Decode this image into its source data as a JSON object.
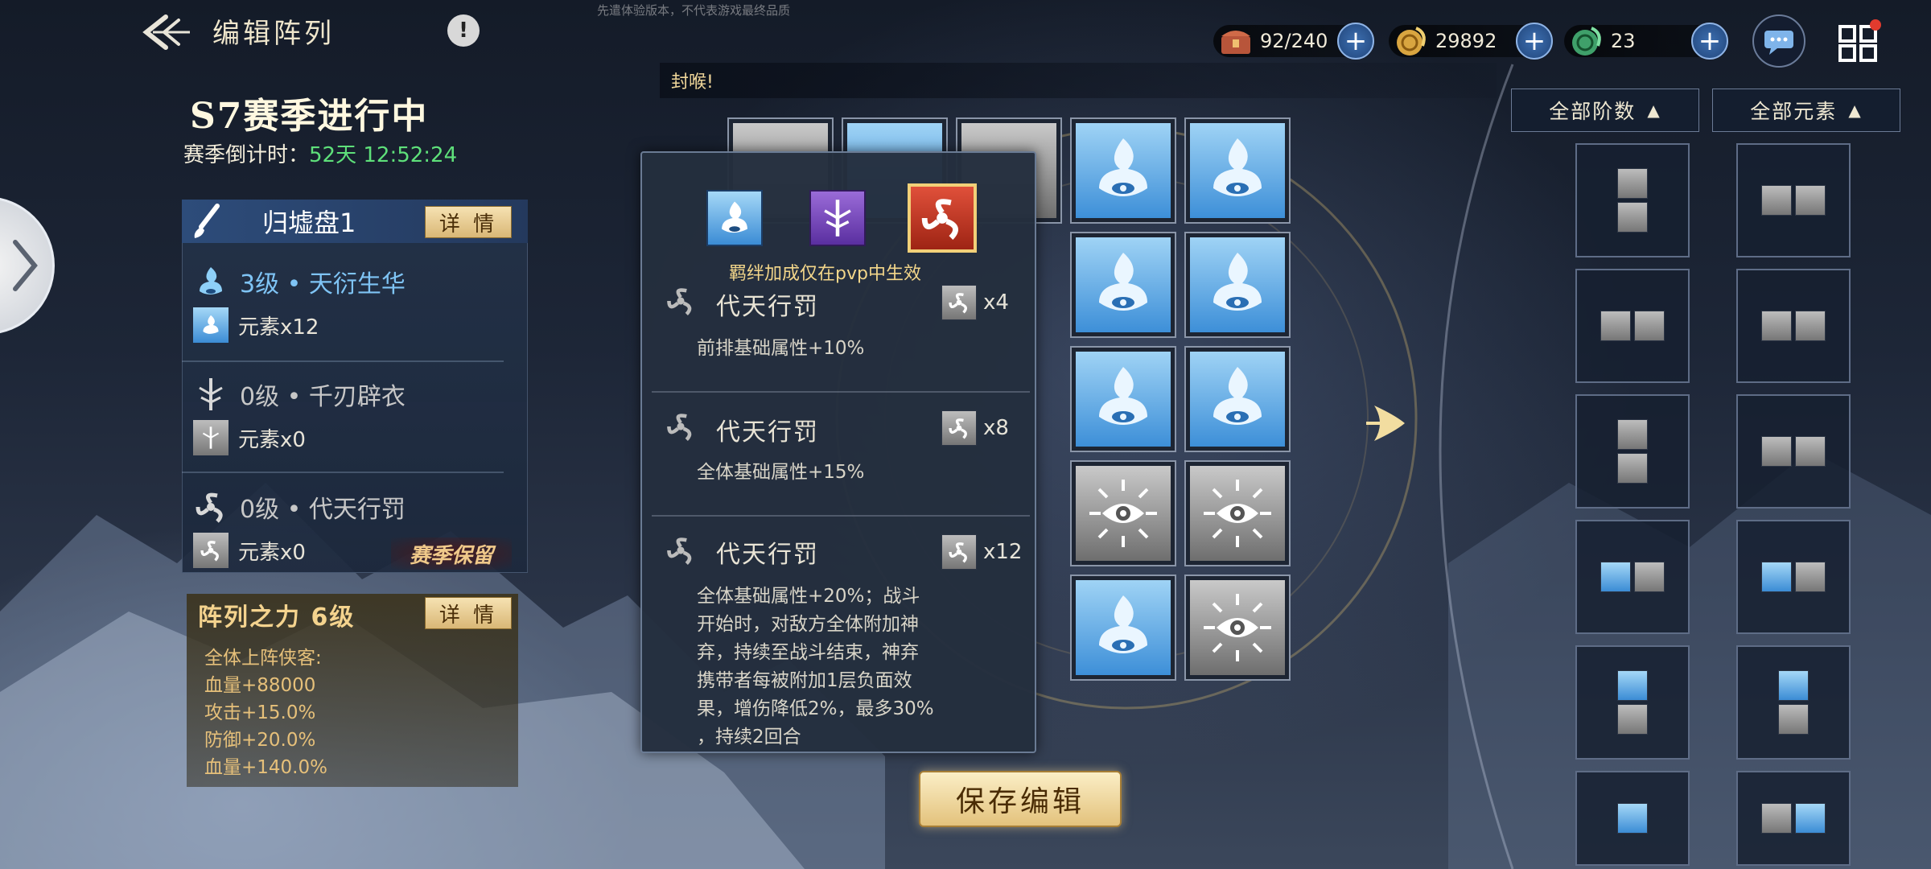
{
  "header": {
    "title": "编辑阵列",
    "info": "!",
    "watermark": "先遣体验版本，不代表游戏最终品质"
  },
  "resources": [
    {
      "name": "chest",
      "value": "92/240"
    },
    {
      "name": "coins",
      "value": "29892"
    },
    {
      "name": "jade",
      "value": "23"
    }
  ],
  "notice": "封喉!",
  "season": {
    "title": "S7赛季进行中",
    "countdown_label": "赛季倒计时：",
    "countdown_value": "52天 12:52:24"
  },
  "formation": {
    "name": "归墟盘1",
    "detail_label": "详 情",
    "bonds": [
      {
        "title": "3级 • 天衍生华",
        "elem": "元素x12",
        "icon": "water-icon"
      },
      {
        "title": "0级 • 千刃辟衣",
        "elem": "元素x0",
        "icon": "sword-icon"
      },
      {
        "title": "0级 • 代天行罚",
        "elem": "元素x0",
        "icon": "triskele-icon"
      }
    ],
    "season_keep": "赛季保留"
  },
  "power": {
    "title": "阵列之力 6级",
    "detail_label": "详 情",
    "lines": [
      "全体上阵侠客:",
      "血量+88000",
      "攻击+15.0%",
      "防御+20.0%",
      "血量+140.0%"
    ]
  },
  "tooltip": {
    "note": "羁绊加成仅在pvp中生效",
    "tiers": [
      {
        "name": "代天行罚",
        "count": "x4",
        "desc": [
          "前排基础属性+10%"
        ]
      },
      {
        "name": "代天行罚",
        "count": "x8",
        "desc": [
          "全体基础属性+15%"
        ]
      },
      {
        "name": "代天行罚",
        "count": "x12",
        "desc": [
          "全体基础属性+20%；战斗",
          "开始时，对敌方全体附加神",
          "弃，持续至战斗结束，神弃",
          "携带者每被附加1层负面效",
          "果，增伤降低2%，最多30%",
          "，持续2回合"
        ]
      }
    ]
  },
  "save_label": "保存编辑",
  "filters": {
    "tier": "全部阶数",
    "element": "全部元素"
  },
  "colors": {
    "accent_gold": "#e3c27c",
    "green_time": "#5ee07a",
    "water_blue": "#3d8fd8"
  }
}
